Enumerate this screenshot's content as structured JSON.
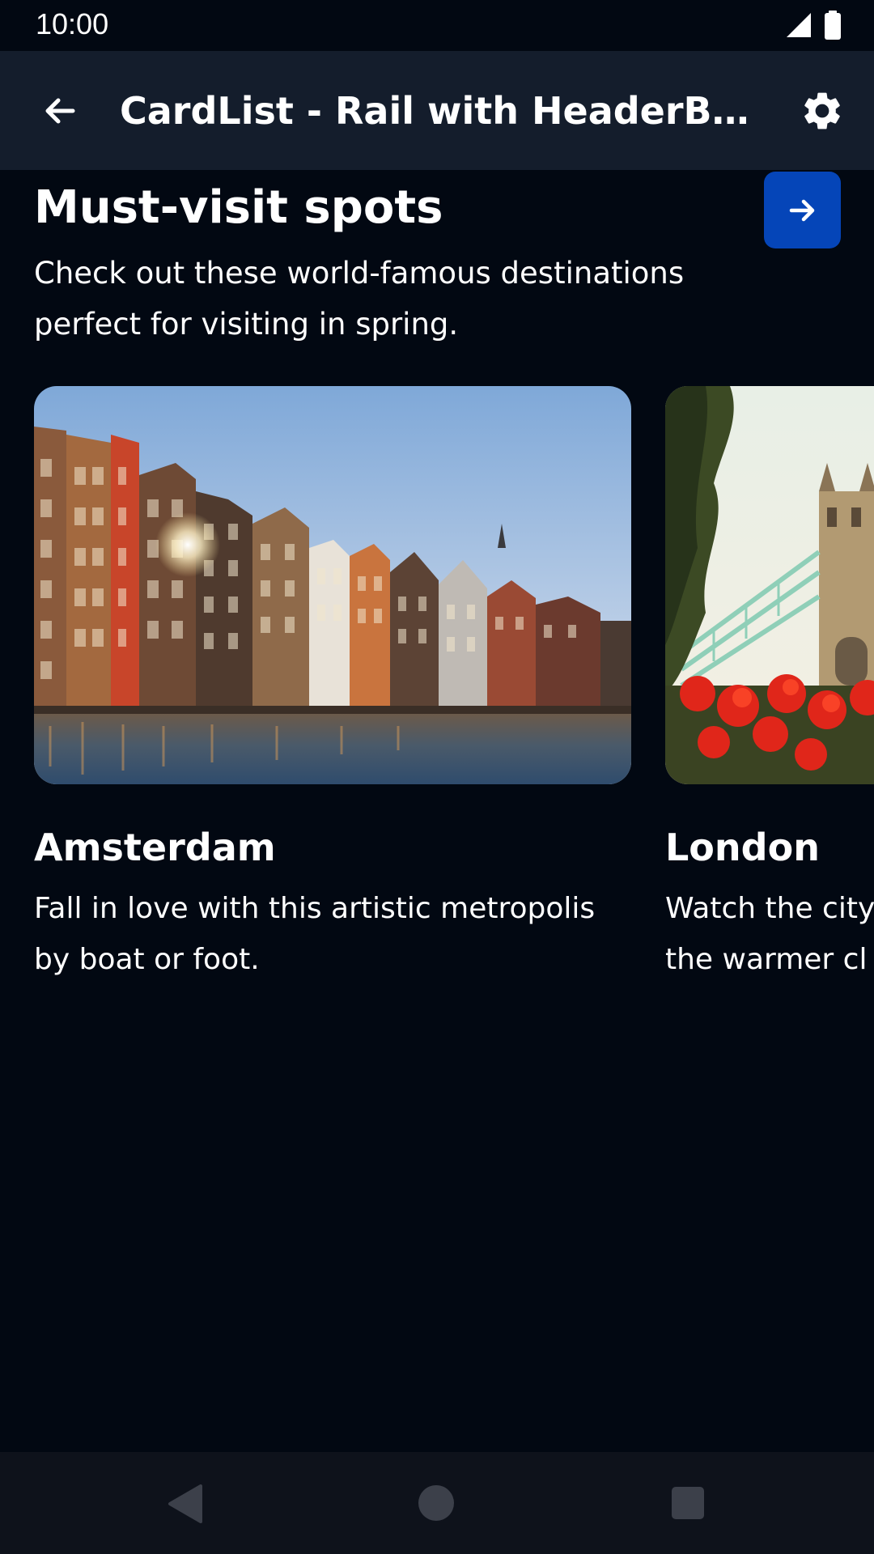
{
  "status_bar": {
    "time": "10:00",
    "icons": [
      "signal-icon",
      "battery-icon"
    ]
  },
  "app_bar": {
    "title": "CardList - Rail with HeaderButt...",
    "back_icon": "arrow-back-icon",
    "settings_icon": "gear-icon"
  },
  "section": {
    "title": "Must-visit spots",
    "description": "Check out these world-famous destinations perfect for visiting in spring.",
    "header_button_icon": "arrow-forward-icon"
  },
  "cards": [
    {
      "title": "Amsterdam",
      "description": "Fall in love with this artistic metropolis by boat or foot."
    },
    {
      "title": "London",
      "description": "Watch the city\nthe warmer cl"
    }
  ],
  "nav_bar": {
    "icons": [
      "nav-back-icon",
      "nav-home-icon",
      "nav-recents-icon"
    ]
  },
  "colors": {
    "background": "#020812",
    "app_bar": "#141d2c",
    "accent_button": "#0545b8",
    "nav_bar": "#0e121b",
    "text": "#ffffff"
  }
}
